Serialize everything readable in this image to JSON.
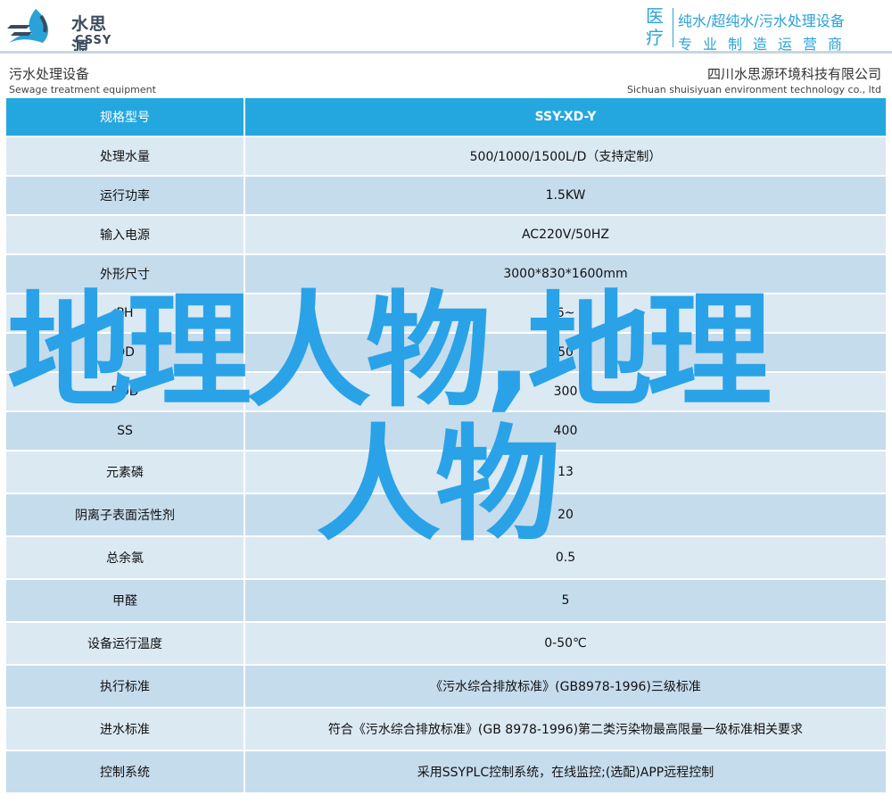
{
  "header": {
    "brand_cn": "水思源",
    "brand_en": "CSSY",
    "tag_big": "医疗",
    "tag_line1": "纯水/超纯水/污水处理设备",
    "tag_line2": "专业制造运营商"
  },
  "titlebar": {
    "category_cn": "污水处理设备",
    "category_en": "Sewage treatment equipment",
    "company_cn": "四川水思源环境科技有限公司",
    "company_en": "Sichuan shuisiyuan environment technology co., ltd"
  },
  "table": {
    "rows": [
      {
        "k": "规格型号",
        "v": "SSY-XD-Y"
      },
      {
        "k": "处理水量",
        "v": "500/1000/1500L/D（支持定制）"
      },
      {
        "k": "运行功率",
        "v": "1.5KW"
      },
      {
        "k": "输入电源",
        "v": "AC220V/50HZ"
      },
      {
        "k": "外形尺寸",
        "v": "3000*830*1600mm"
      },
      {
        "k": "PH",
        "v": "6~"
      },
      {
        "k": "OD",
        "v": "50"
      },
      {
        "k": "BOD",
        "v": "300"
      },
      {
        "k": "SS",
        "v": "400"
      },
      {
        "k": "元素磷",
        "v": "13"
      },
      {
        "k": "阴离子表面活性剂",
        "v": "20"
      },
      {
        "k": "总余氯",
        "v": "0.5"
      },
      {
        "k": "甲醛",
        "v": "5"
      },
      {
        "k": "设备运行温度",
        "v": "0-50℃"
      },
      {
        "k": "执行标准",
        "v": "《污水综合排放标准》(GB8978-1996)三级标准"
      },
      {
        "k": "进水标准",
        "v": "符合《污水综合排放标准》(GB 8978-1996)第二类污染物最高限量一级标准相关要求"
      },
      {
        "k": "控制系统",
        "v": "采用SSYPLC控制系统，在线监控;(选配)APP远程控制"
      }
    ]
  },
  "overlay": {
    "line1": "地理人物,地理",
    "line2": "人物"
  },
  "colors": {
    "accent": "#24a7df",
    "row_light": "#dbe9f3",
    "row_dark": "#c5dced",
    "overlay": "#2aa2e8"
  }
}
